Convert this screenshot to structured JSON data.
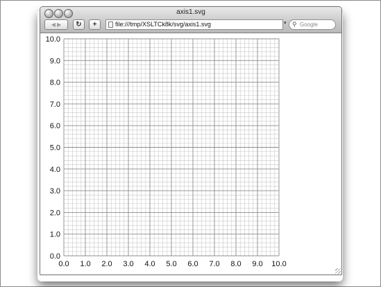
{
  "window": {
    "title": "axis1.svg"
  },
  "toolbar": {
    "back_forward_label": "◀ ▶",
    "reload_label": "↻",
    "add_label": "+",
    "url": "file:///tmp/XSLTCk8k/svg/axis1.svg",
    "search_placeholder": "Google"
  },
  "icons": {
    "back-forward": "arrow-icons",
    "reload": "reload-icon",
    "add": "plus-icon",
    "search": "search-icon",
    "document": "document-icon",
    "resize": "resize-grip-icon"
  },
  "chart_data": {
    "type": "scatter",
    "title": "",
    "xlabel": "",
    "ylabel": "",
    "xlim": [
      0,
      10
    ],
    "ylim": [
      0,
      10
    ],
    "x_ticks": [
      "0.0",
      "1.0",
      "2.0",
      "3.0",
      "4.0",
      "5.0",
      "6.0",
      "7.0",
      "8.0",
      "9.0",
      "10.0"
    ],
    "y_ticks": [
      "0.0",
      "1.0",
      "2.0",
      "3.0",
      "4.0",
      "5.0",
      "6.0",
      "7.0",
      "8.0",
      "9.0",
      "10.0"
    ],
    "grid": true,
    "minor_grid_step": 0.2,
    "series": [],
    "colors": {
      "major_grid": "#8c8c8c",
      "minor_grid": "#c8c8c8"
    }
  }
}
